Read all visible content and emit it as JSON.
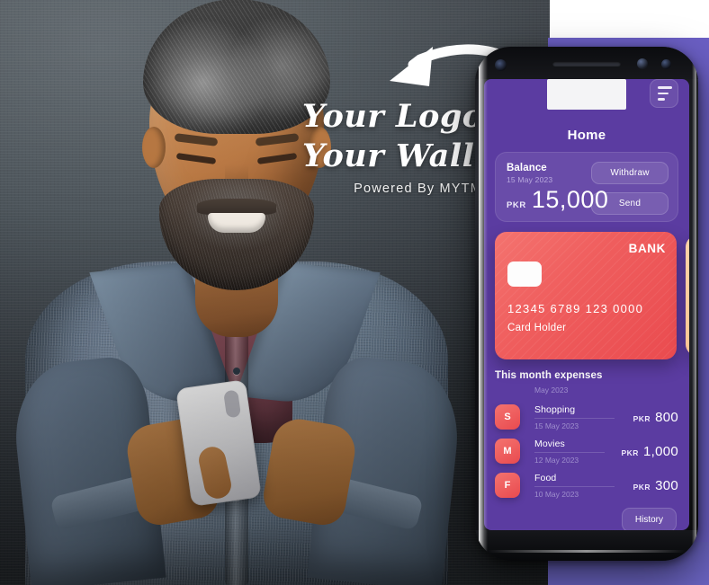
{
  "hero": {
    "logo_line_1": "Your Logo",
    "logo_line_2": "Your Wallet",
    "powered_by": "Powered By  MYTM",
    "arrow_icon": "curved-arrow-icon",
    "photo_alt": "smiling-man-using-phone"
  },
  "colors": {
    "app_purple": "#5B3CA1",
    "backdrop_purple": "#6A63C0",
    "card_red": "#EF5D5D",
    "card_peach": "#FFC08A",
    "photo_gray": "#4D555B"
  },
  "phone": {
    "device": "smartphone-mockup",
    "app": {
      "top": {
        "logo_placeholder": "",
        "menu_icon": "hamburger-menu-icon"
      },
      "title": "Home",
      "balance": {
        "label": "Balance",
        "date": "15 May 2023",
        "currency": "PKR",
        "amount": "15,000",
        "withdraw_label": "Withdraw",
        "send_label": "Send"
      },
      "bank_card": {
        "brand": "BANK",
        "chip_icon": "card-chip-icon",
        "number": "12345 6789 123 0000",
        "holder": "Card Holder"
      },
      "expenses": {
        "heading": "This month expenses",
        "subheading": "May 2023",
        "items": [
          {
            "initial": "S",
            "name": "Shopping",
            "date": "15 May 2023",
            "currency": "PKR",
            "amount": "800"
          },
          {
            "initial": "M",
            "name": "Movies",
            "date": "12 May 2023",
            "currency": "PKR",
            "amount": "1,000"
          },
          {
            "initial": "F",
            "name": "Food",
            "date": "10 May 2023",
            "currency": "PKR",
            "amount": "300"
          }
        ],
        "history_label": "History"
      }
    }
  }
}
